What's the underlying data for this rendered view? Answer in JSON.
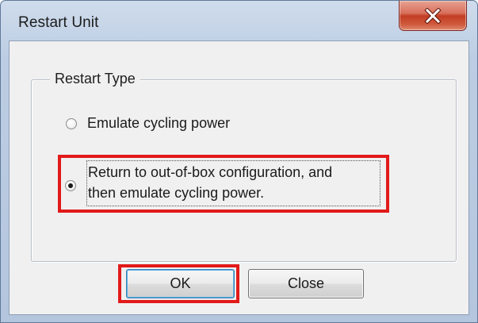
{
  "window": {
    "title": "Restart Unit",
    "close_glyph": "x"
  },
  "group": {
    "legend": "Restart Type"
  },
  "options": [
    {
      "label_lines": [
        "Emulate cycling power"
      ],
      "selected": false
    },
    {
      "label_lines": [
        "Return to out-of-box configuration, and",
        "then emulate cycling power."
      ],
      "selected": true
    }
  ],
  "buttons": {
    "ok_label": "OK",
    "close_label": "Close"
  },
  "colors": {
    "highlight_outline": "#e21a1a",
    "close_button": "#c23d23"
  }
}
